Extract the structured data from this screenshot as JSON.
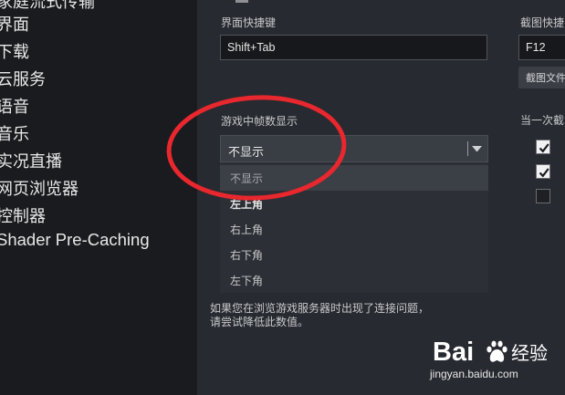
{
  "sidebar": {
    "items": [
      {
        "label": "家庭流式传输",
        "partial": true
      },
      {
        "label": "界面"
      },
      {
        "label": "下载"
      },
      {
        "label": "云服务"
      },
      {
        "label": "语音"
      },
      {
        "label": "音乐"
      },
      {
        "label": "实况直播"
      },
      {
        "label": "网页浏览器"
      },
      {
        "label": "控制器"
      },
      {
        "label": "Shader Pre-Caching"
      }
    ]
  },
  "main": {
    "overlay_shortcut": {
      "label": "界面快捷键",
      "value": "Shift+Tab"
    },
    "screenshot_shortcut": {
      "label": "截图快捷",
      "value": "F12",
      "folder_button": "截图文件夹"
    },
    "fps_display": {
      "label": "游戏中帧数显示",
      "selected": "不显示",
      "options": [
        "不显示",
        "左上角",
        "右上角",
        "右下角",
        "左下角"
      ]
    },
    "when_screenshot": {
      "label": "当一次截",
      "checkboxes": [
        true,
        true,
        false
      ]
    },
    "note": [
      "如果您在浏览游戏服务器时出现了连接问题，",
      "请尝试降低此数值。"
    ]
  },
  "watermark": {
    "brand": "Bai",
    "brand_suffix": "经验",
    "url": "jingyan.baidu.com"
  },
  "colors": {
    "highlight_ellipse": "#e8272e",
    "panel": "#272a30",
    "sidebar": "#1a1b1e"
  }
}
